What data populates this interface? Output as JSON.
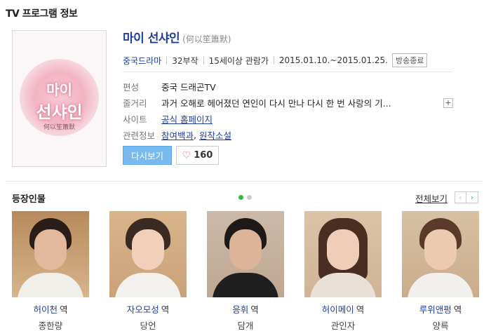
{
  "section": {
    "title": "TV 프로그램 정보"
  },
  "poster": {
    "title_line1": "마이",
    "title_line2": "선샤인",
    "subtitle": "何以笙簫默"
  },
  "program": {
    "title": "마이 선샤인",
    "original_title": "(何以笙簫默)",
    "genre": "중국드라마",
    "episodes": "32부작",
    "rating": "15세이상 관람가",
    "period": "2015.01.10.~2015.01.25.",
    "status_badge": "방송종료",
    "rows": {
      "channel_label": "편성",
      "channel_value": "중국 드래곤TV",
      "plot_label": "줄거리",
      "plot_value": "과거 오해로 헤어졌던 연인이 다시 만나 다시 한 번 사랑의 기...",
      "site_label": "사이트",
      "site_value": "공식 홈페이지",
      "related_label": "관련정보",
      "related_link1": "참여백과",
      "related_link2": "원작소설"
    },
    "replay_label": "다시보기",
    "like_count": "160"
  },
  "cast_section": {
    "title": "등장인물",
    "view_all": "전체보기"
  },
  "cast": [
    {
      "character": "허이천",
      "role": "역",
      "actor": "종한량"
    },
    {
      "character": "자오모성",
      "role": "역",
      "actor": "당언"
    },
    {
      "character": "응휘",
      "role": "역",
      "actor": "담개"
    },
    {
      "character": "허이메이",
      "role": "역",
      "actor": "관인자"
    },
    {
      "character": "루위앤펑",
      "role": "역",
      "actor": "양륵"
    }
  ],
  "colors": {
    "link": "#1f3d9c",
    "accent_green": "#3ab54a",
    "replay_button": "#78b9f0",
    "heart": "#e0405a"
  },
  "icons": {
    "more": "plus-icon",
    "like": "heart-icon",
    "prev": "chevron-left-icon",
    "next": "chevron-right-icon"
  }
}
